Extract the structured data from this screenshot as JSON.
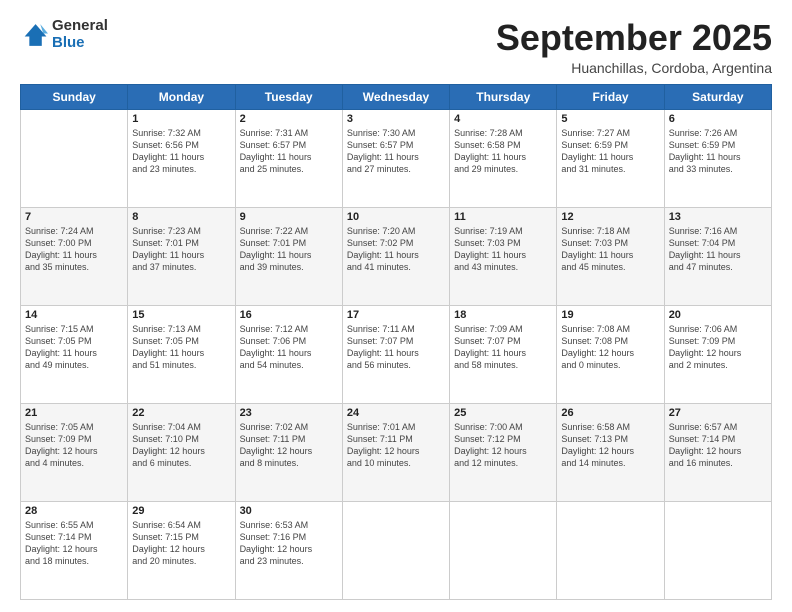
{
  "logo": {
    "general": "General",
    "blue": "Blue"
  },
  "title": "September 2025",
  "location": "Huanchillas, Cordoba, Argentina",
  "days": [
    "Sunday",
    "Monday",
    "Tuesday",
    "Wednesday",
    "Thursday",
    "Friday",
    "Saturday"
  ],
  "weeks": [
    [
      {
        "day": "",
        "info": ""
      },
      {
        "day": "1",
        "info": "Sunrise: 7:32 AM\nSunset: 6:56 PM\nDaylight: 11 hours\nand 23 minutes."
      },
      {
        "day": "2",
        "info": "Sunrise: 7:31 AM\nSunset: 6:57 PM\nDaylight: 11 hours\nand 25 minutes."
      },
      {
        "day": "3",
        "info": "Sunrise: 7:30 AM\nSunset: 6:57 PM\nDaylight: 11 hours\nand 27 minutes."
      },
      {
        "day": "4",
        "info": "Sunrise: 7:28 AM\nSunset: 6:58 PM\nDaylight: 11 hours\nand 29 minutes."
      },
      {
        "day": "5",
        "info": "Sunrise: 7:27 AM\nSunset: 6:59 PM\nDaylight: 11 hours\nand 31 minutes."
      },
      {
        "day": "6",
        "info": "Sunrise: 7:26 AM\nSunset: 6:59 PM\nDaylight: 11 hours\nand 33 minutes."
      }
    ],
    [
      {
        "day": "7",
        "info": "Sunrise: 7:24 AM\nSunset: 7:00 PM\nDaylight: 11 hours\nand 35 minutes."
      },
      {
        "day": "8",
        "info": "Sunrise: 7:23 AM\nSunset: 7:01 PM\nDaylight: 11 hours\nand 37 minutes."
      },
      {
        "day": "9",
        "info": "Sunrise: 7:22 AM\nSunset: 7:01 PM\nDaylight: 11 hours\nand 39 minutes."
      },
      {
        "day": "10",
        "info": "Sunrise: 7:20 AM\nSunset: 7:02 PM\nDaylight: 11 hours\nand 41 minutes."
      },
      {
        "day": "11",
        "info": "Sunrise: 7:19 AM\nSunset: 7:03 PM\nDaylight: 11 hours\nand 43 minutes."
      },
      {
        "day": "12",
        "info": "Sunrise: 7:18 AM\nSunset: 7:03 PM\nDaylight: 11 hours\nand 45 minutes."
      },
      {
        "day": "13",
        "info": "Sunrise: 7:16 AM\nSunset: 7:04 PM\nDaylight: 11 hours\nand 47 minutes."
      }
    ],
    [
      {
        "day": "14",
        "info": "Sunrise: 7:15 AM\nSunset: 7:05 PM\nDaylight: 11 hours\nand 49 minutes."
      },
      {
        "day": "15",
        "info": "Sunrise: 7:13 AM\nSunset: 7:05 PM\nDaylight: 11 hours\nand 51 minutes."
      },
      {
        "day": "16",
        "info": "Sunrise: 7:12 AM\nSunset: 7:06 PM\nDaylight: 11 hours\nand 54 minutes."
      },
      {
        "day": "17",
        "info": "Sunrise: 7:11 AM\nSunset: 7:07 PM\nDaylight: 11 hours\nand 56 minutes."
      },
      {
        "day": "18",
        "info": "Sunrise: 7:09 AM\nSunset: 7:07 PM\nDaylight: 11 hours\nand 58 minutes."
      },
      {
        "day": "19",
        "info": "Sunrise: 7:08 AM\nSunset: 7:08 PM\nDaylight: 12 hours\nand 0 minutes."
      },
      {
        "day": "20",
        "info": "Sunrise: 7:06 AM\nSunset: 7:09 PM\nDaylight: 12 hours\nand 2 minutes."
      }
    ],
    [
      {
        "day": "21",
        "info": "Sunrise: 7:05 AM\nSunset: 7:09 PM\nDaylight: 12 hours\nand 4 minutes."
      },
      {
        "day": "22",
        "info": "Sunrise: 7:04 AM\nSunset: 7:10 PM\nDaylight: 12 hours\nand 6 minutes."
      },
      {
        "day": "23",
        "info": "Sunrise: 7:02 AM\nSunset: 7:11 PM\nDaylight: 12 hours\nand 8 minutes."
      },
      {
        "day": "24",
        "info": "Sunrise: 7:01 AM\nSunset: 7:11 PM\nDaylight: 12 hours\nand 10 minutes."
      },
      {
        "day": "25",
        "info": "Sunrise: 7:00 AM\nSunset: 7:12 PM\nDaylight: 12 hours\nand 12 minutes."
      },
      {
        "day": "26",
        "info": "Sunrise: 6:58 AM\nSunset: 7:13 PM\nDaylight: 12 hours\nand 14 minutes."
      },
      {
        "day": "27",
        "info": "Sunrise: 6:57 AM\nSunset: 7:14 PM\nDaylight: 12 hours\nand 16 minutes."
      }
    ],
    [
      {
        "day": "28",
        "info": "Sunrise: 6:55 AM\nSunset: 7:14 PM\nDaylight: 12 hours\nand 18 minutes."
      },
      {
        "day": "29",
        "info": "Sunrise: 6:54 AM\nSunset: 7:15 PM\nDaylight: 12 hours\nand 20 minutes."
      },
      {
        "day": "30",
        "info": "Sunrise: 6:53 AM\nSunset: 7:16 PM\nDaylight: 12 hours\nand 23 minutes."
      },
      {
        "day": "",
        "info": ""
      },
      {
        "day": "",
        "info": ""
      },
      {
        "day": "",
        "info": ""
      },
      {
        "day": "",
        "info": ""
      }
    ]
  ]
}
